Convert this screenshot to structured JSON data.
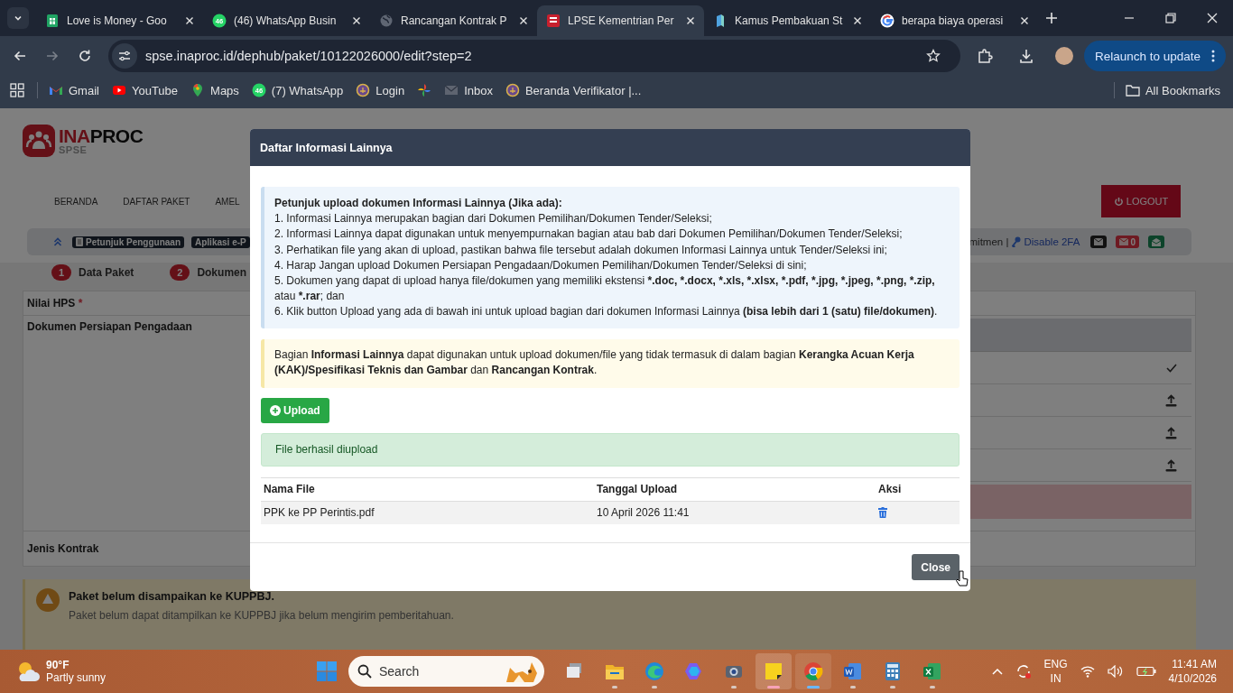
{
  "browser": {
    "tabs": [
      {
        "title": "Love is Money - Goo",
        "kind": "sheets",
        "selected": false
      },
      {
        "title": "(46) WhatsApp Busin",
        "kind": "whatsapp",
        "badge": "46",
        "selected": false
      },
      {
        "title": "Rancangan Kontrak P",
        "kind": "globe",
        "selected": false
      },
      {
        "title": "LPSE Kementrian Per",
        "kind": "lpse",
        "selected": true
      },
      {
        "title": "Kamus Pembakuan St",
        "kind": "book",
        "selected": false
      },
      {
        "title": "berapa biaya operasi",
        "kind": "google",
        "selected": false
      }
    ],
    "url": "spse.inaproc.id/dephub/paket/10122026000/edit?step=2",
    "relaunch": "Relaunch to update",
    "bookmarks": [
      {
        "label": "Gmail",
        "kind": "gmail"
      },
      {
        "label": "YouTube",
        "kind": "youtube"
      },
      {
        "label": "Maps",
        "kind": "maps"
      },
      {
        "label": "(7) WhatsApp",
        "kind": "whatsapp",
        "badge": "46"
      },
      {
        "label": "Login",
        "kind": "emblem"
      },
      {
        "kind": "pinwheel"
      },
      {
        "label": "Inbox",
        "kind": "mail"
      },
      {
        "label": "Beranda Verifikator |...",
        "kind": "emblem"
      }
    ],
    "all_bookmarks": "All Bookmarks"
  },
  "page": {
    "logo": {
      "parts": [
        "INA",
        "PROC"
      ],
      "sub": "SPSE"
    },
    "nav": [
      "BERANDA",
      "DAFTAR PAKET",
      "AMEL"
    ],
    "logout": "LOGOUT",
    "toolbar": {
      "chips": [
        "Petunjuk Penggunaan",
        "Aplikasi e-P"
      ],
      "right_text": "mitmen |",
      "link": "Disable 2FA",
      "mail_count": "0"
    },
    "steps": [
      {
        "number": "1",
        "label": "Data Paket"
      },
      {
        "number": "2",
        "label": "Dokumen"
      }
    ],
    "form": {
      "hps_label": "Nilai HPS",
      "required_mark": "*",
      "docs_label": "Dokumen Persiapan Pengadaan",
      "contract_label": "Jenis Kontrak",
      "doc_rows": [
        {
          "kind": "done"
        },
        {
          "kind": "upload"
        },
        {
          "kind": "upload"
        },
        {
          "kind": "upload"
        },
        {
          "kind": "missing"
        }
      ]
    },
    "alert": {
      "title": "Paket belum disampaikan ke KUPPBJ.",
      "text": "Paket belum dapat ditampilkan ke KUPPBJ jika belum mengirim pemberitahuan."
    }
  },
  "modal": {
    "title": "Daftar Informasi Lainnya",
    "info_title": "Petunjuk upload dokumen Informasi Lainnya (Jika ada):",
    "info_items": [
      [
        {
          "text": "1. Informasi Lainnya merupakan bagian dari Dokumen Pemilihan/Dokumen Tender/Seleksi;",
          "bold": false
        }
      ],
      [
        {
          "text": "2. Informasi Lainnya dapat digunakan untuk menyempurnakan bagian atau bab dari Dokumen Pemilihan/Dokumen Tender/Seleksi;",
          "bold": false
        }
      ],
      [
        {
          "text": "3. Perhatikan file yang akan di upload, pastikan bahwa file tersebut adalah dokumen Informasi Lainnya untuk Tender/Seleksi ini;",
          "bold": false
        }
      ],
      [
        {
          "text": "4. Harap Jangan upload Dokumen Persiapan Pengadaan/Dokumen Pemilihan/Dokumen Tender/Seleksi di sini;",
          "bold": false
        }
      ],
      [
        {
          "text": "5. Dokumen yang dapat di upload hanya file/dokumen yang memiliki ekstensi ",
          "bold": false
        },
        {
          "text": "*.doc, *.docx, *.xls, *.xlsx, *.pdf, *.jpg, *.jpeg, *.png, *.zip,",
          "bold": true
        },
        {
          "text": " atau ",
          "bold": false
        },
        {
          "text": "*.rar",
          "bold": true
        },
        {
          "text": "; dan",
          "bold": false
        }
      ],
      [
        {
          "text": "6. Klik button Upload yang ada di bawah ini untuk upload bagian dari dokumen Informasi Lainnya ",
          "bold": false
        },
        {
          "text": "(bisa lebih dari 1 (satu) file/dokumen)",
          "bold": true
        },
        {
          "text": ".",
          "bold": false
        }
      ]
    ],
    "note": [
      {
        "text": "Bagian ",
        "bold": false
      },
      {
        "text": "Informasi Lainnya",
        "bold": true
      },
      {
        "text": " dapat digunakan untuk upload dokumen/file yang tidak termasuk di dalam bagian ",
        "bold": false
      },
      {
        "text": "Kerangka Acuan Kerja (KAK)/Spesifikasi Teknis dan Gambar",
        "bold": true
      },
      {
        "text": " dan ",
        "bold": false
      },
      {
        "text": "Rancangan Kontrak",
        "bold": true
      },
      {
        "text": ".",
        "bold": false
      }
    ],
    "upload": "Upload",
    "success": "File berhasil diupload",
    "columns": [
      "Nama File",
      "Tanggal Upload",
      "Aksi"
    ],
    "rows": [
      {
        "name": "PPK ke PP Perintis.pdf",
        "date": "10 April 2026 11:41"
      }
    ],
    "close": "Close"
  },
  "taskbar": {
    "temp": "90°F",
    "weather": "Partly sunny",
    "search": "Search",
    "apps": [
      {
        "kind": "taskview",
        "running": false,
        "focused": false,
        "attention": false
      },
      {
        "kind": "folder",
        "running": true,
        "focused": false,
        "attention": false
      },
      {
        "kind": "edge",
        "running": true,
        "focused": false,
        "attention": false
      },
      {
        "kind": "copilot",
        "running": false,
        "focused": false,
        "attention": false
      },
      {
        "kind": "camera",
        "running": true,
        "focused": false,
        "attention": false
      },
      {
        "kind": "sticky",
        "running": true,
        "focused": false,
        "attention": true
      },
      {
        "kind": "chrome",
        "running": true,
        "focused": true,
        "attention": false
      },
      {
        "kind": "word",
        "running": true,
        "focused": false,
        "attention": false
      },
      {
        "kind": "calculator",
        "running": true,
        "focused": false,
        "attention": false
      },
      {
        "kind": "excel",
        "running": true,
        "focused": false,
        "attention": false
      }
    ],
    "lang": "ENG",
    "region": "IN",
    "time": "11:41 AM",
    "date": "4/10/2026"
  }
}
